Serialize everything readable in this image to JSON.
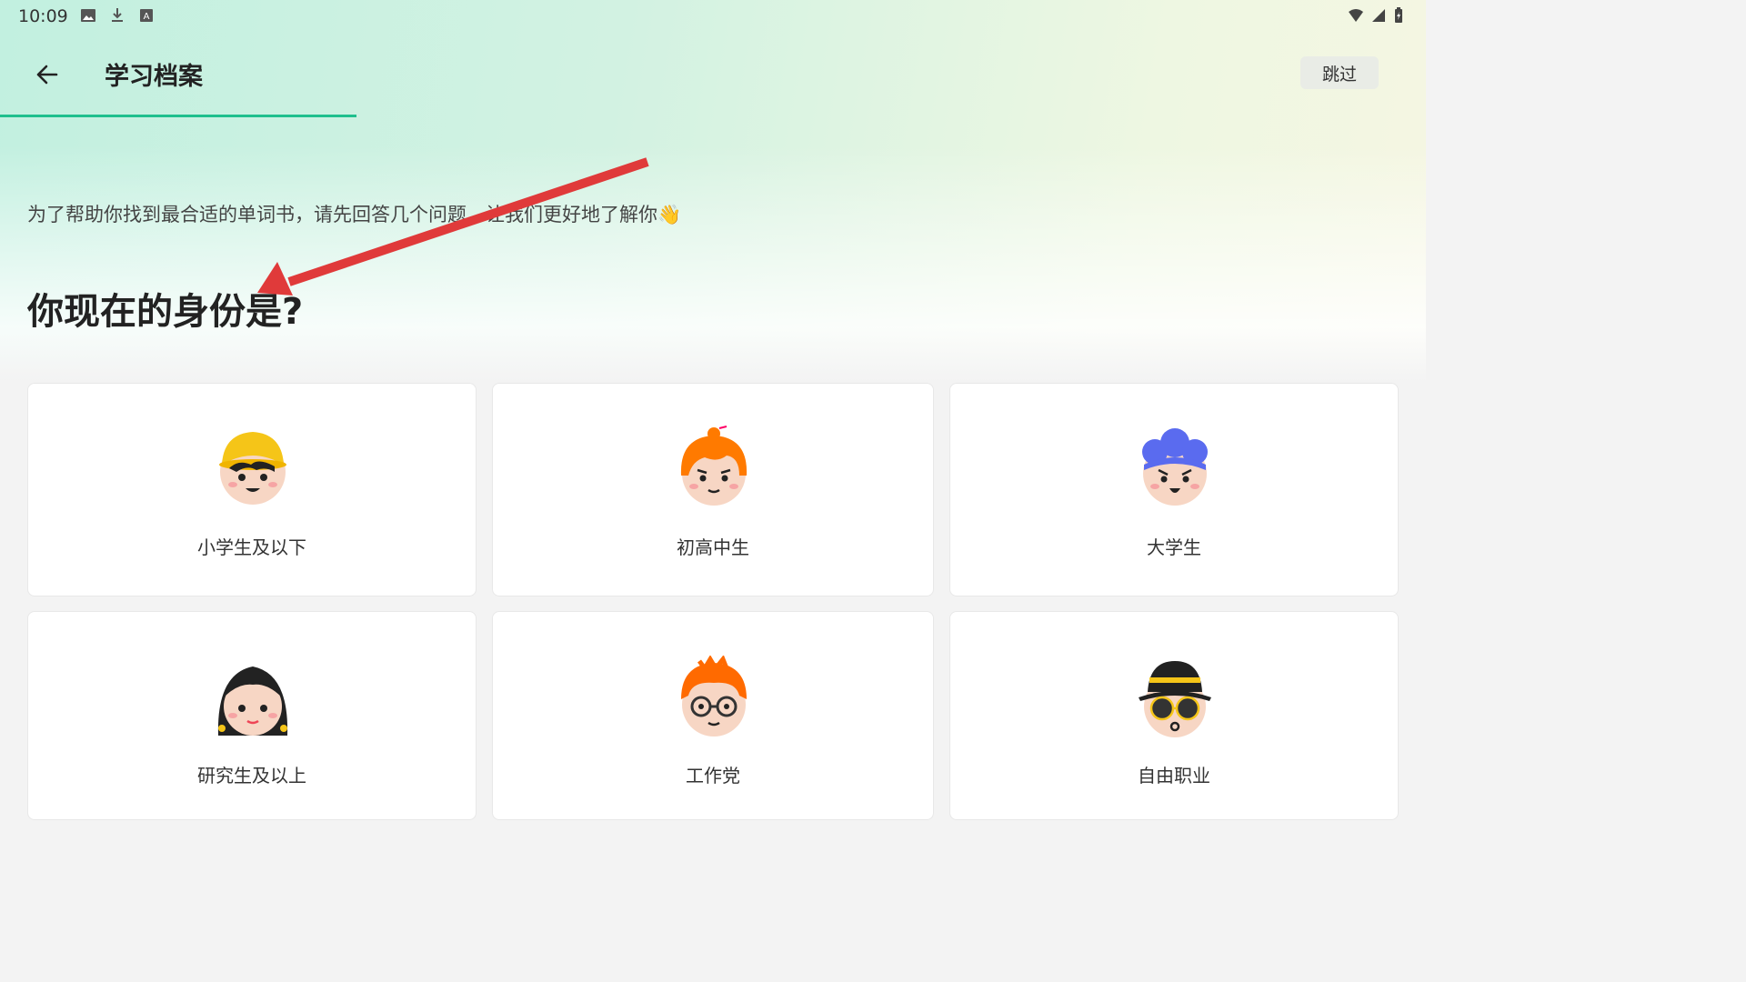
{
  "status_bar": {
    "time": "10:09"
  },
  "toolbar": {
    "title": "学习档案",
    "skip_label": "跳过"
  },
  "progress": {
    "fraction": 0.25,
    "color": "#1fbf8d"
  },
  "intro": {
    "text": "为了帮助你找到最合适的单词书，请先回答几个问题，让我们更好地了解你👋"
  },
  "question": {
    "text": "你现在的身份是?"
  },
  "options": [
    {
      "label": "小学生及以下"
    },
    {
      "label": "初高中生"
    },
    {
      "label": "大学生"
    },
    {
      "label": "研究生及以上"
    },
    {
      "label": "工作党"
    },
    {
      "label": "自由职业"
    }
  ],
  "annotation": {
    "arrow_color": "#e03a3a"
  }
}
